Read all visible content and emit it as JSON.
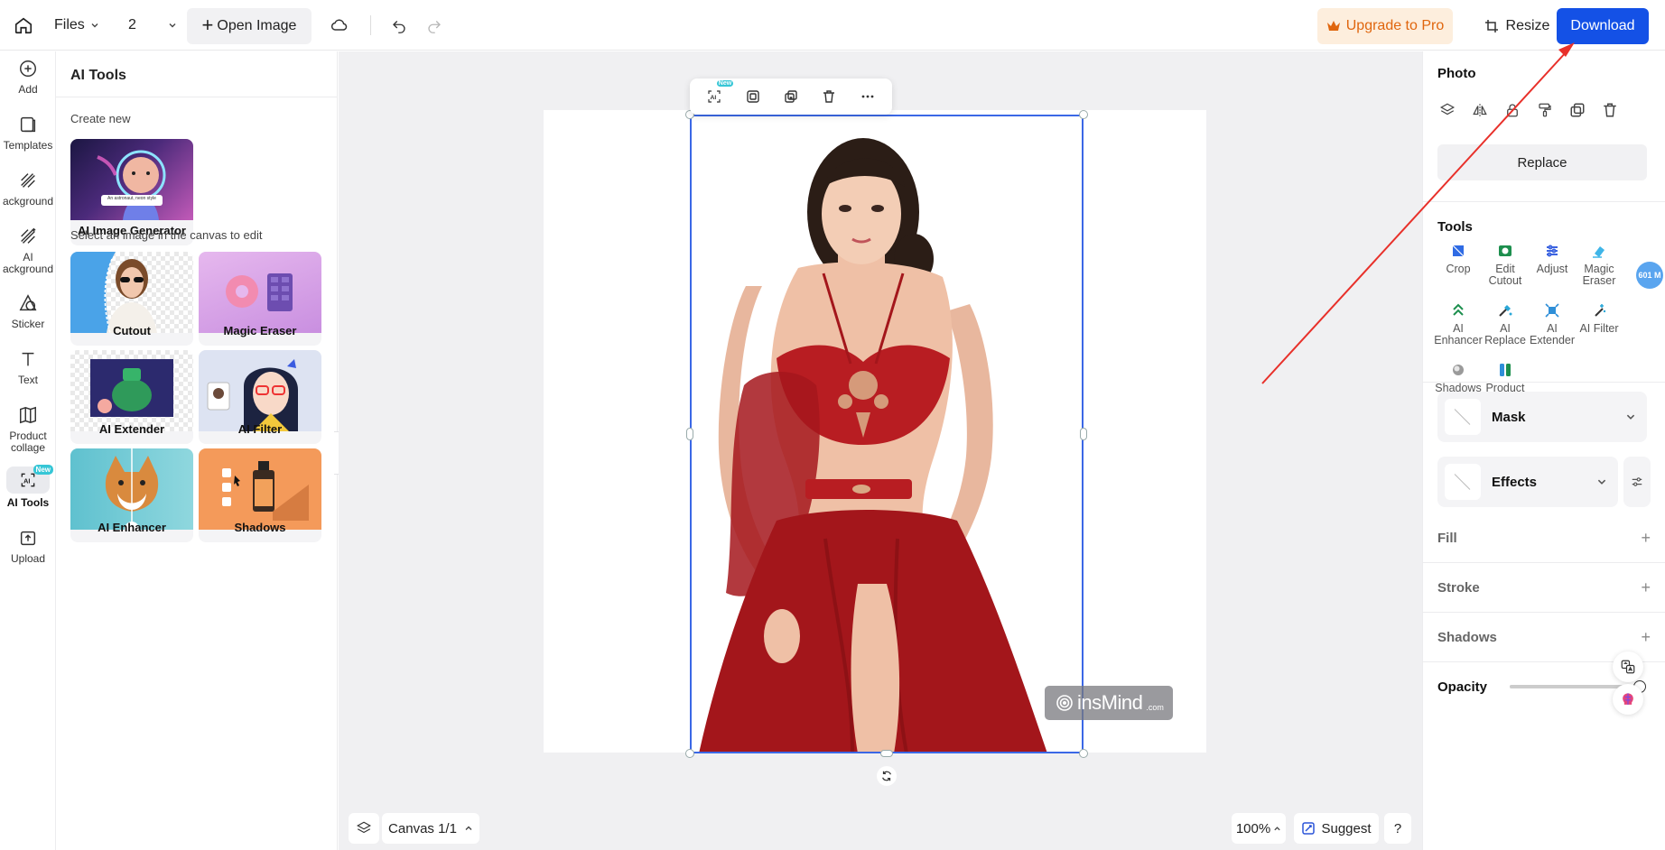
{
  "topbar": {
    "files_label": "Files",
    "page_count": "2",
    "open_image_label": "Open Image",
    "upgrade_label": "Upgrade to Pro",
    "resize_label": "Resize",
    "download_label": "Download"
  },
  "rail": {
    "items": [
      {
        "label": "Add",
        "icon": "plus-circle-icon"
      },
      {
        "label": "Templates",
        "icon": "templates-icon"
      },
      {
        "label": "ackground",
        "icon": "background-icon"
      },
      {
        "label": "AI\nackground",
        "icon": "ai-background-icon"
      },
      {
        "label": "Sticker",
        "icon": "sticker-icon"
      },
      {
        "label": "Text",
        "icon": "text-icon"
      },
      {
        "label": "Product\ncollage",
        "icon": "collage-icon"
      },
      {
        "label": "AI Tools",
        "icon": "ai-tools-icon",
        "badge": "New"
      },
      {
        "label": "Upload",
        "icon": "upload-icon"
      }
    ]
  },
  "panel": {
    "title": "AI Tools",
    "create_new": "Create new",
    "generator_label": "AI Image Generator",
    "generator_thumb_caption": "An astronaut, neon style",
    "select_hint": "Select an image in the canvas to edit",
    "cards": [
      {
        "label": "Cutout"
      },
      {
        "label": "Magic Eraser"
      },
      {
        "label": "AI Extender"
      },
      {
        "label": "AI Filter"
      },
      {
        "label": "AI Enhancer"
      },
      {
        "label": "Shadows"
      }
    ]
  },
  "canvas": {
    "toolbar_badge": "New",
    "watermark_brand": "insMind",
    "watermark_tld": ".com",
    "canvas_label": "Canvas 1/1",
    "zoom_label": "100%",
    "suggest_label": "Suggest",
    "help_label": "?"
  },
  "right_panel": {
    "photo_title": "Photo",
    "replace_label": "Replace",
    "tools_title": "Tools",
    "tools": [
      {
        "label": "Crop",
        "icon": "crop-icon"
      },
      {
        "label": "Edit\nCutout",
        "icon": "edit-cutout-icon"
      },
      {
        "label": "Adjust",
        "icon": "adjust-icon"
      },
      {
        "label": "Magic\nEraser",
        "icon": "magic-eraser-icon"
      },
      {
        "label": "AI\nEnhancer",
        "icon": "ai-enhancer-icon"
      },
      {
        "label": "AI\nReplace",
        "icon": "ai-replace-icon"
      },
      {
        "label": "AI\nExtender",
        "icon": "ai-extender-icon"
      },
      {
        "label": "AI Filter",
        "icon": "ai-filter-icon"
      },
      {
        "label": "Shadows",
        "icon": "shadows-icon"
      },
      {
        "label": "Product\ncollage",
        "icon": "product-collage-icon"
      }
    ],
    "size_bubble": "601 M",
    "mask_label": "Mask",
    "effects_label": "Effects",
    "fill_label": "Fill",
    "stroke_label": "Stroke",
    "shadows_label": "Shadows",
    "opacity_label": "Opacity",
    "opacity_value": 1.0
  },
  "colors": {
    "accent": "#1451e6",
    "selection": "#3b68e6",
    "upgrade_bg": "#fdeedd",
    "upgrade_text": "#e0660e",
    "new_badge": "#36c6d6",
    "annotation_arrow": "#e8302a"
  }
}
